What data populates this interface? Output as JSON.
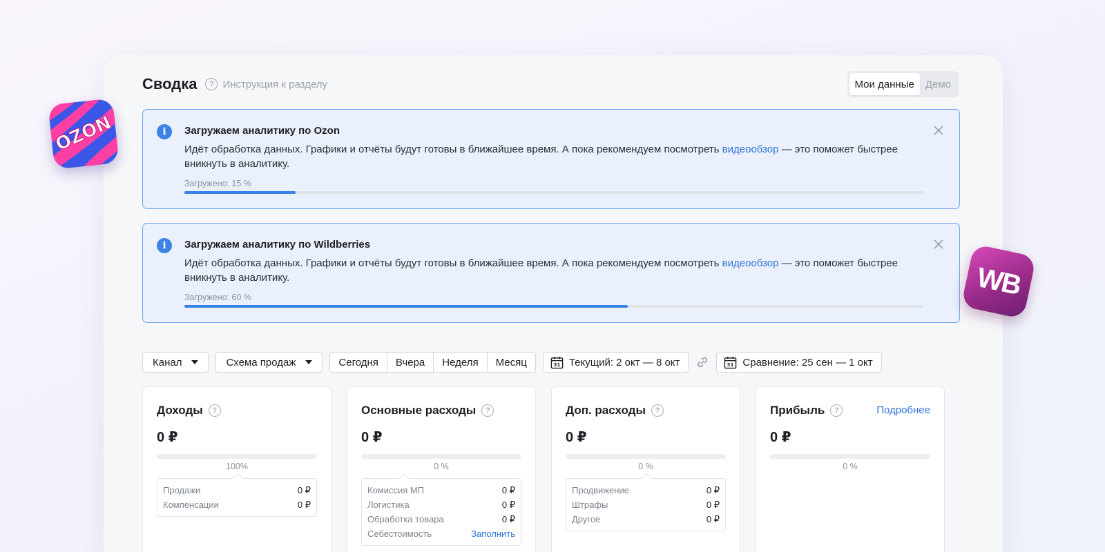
{
  "header": {
    "title": "Сводка",
    "help_label": "Инструкция к разделу",
    "toggle": {
      "mine": "Мои данные",
      "demo": "Демо"
    }
  },
  "alerts": [
    {
      "title": "Загружаем аналитику по Ozon",
      "text_before": "Идёт обработка данных. Графики и отчёты будут готовы в ближайшее время. А пока рекомендуем посмотреть ",
      "link": "видеообзор",
      "text_after": " — это поможет быстрее вникнуть в аналитику.",
      "progress_label": "Загружено: 15 %",
      "progress": 15
    },
    {
      "title": "Загружаем аналитику по Wildberries",
      "text_before": "Идёт обработка данных. Графики и отчёты будут готовы в ближайшее время. А пока рекомендуем посмотреть ",
      "link": "видеообзор",
      "text_after": " — это поможет быстрее вникнуть в аналитику.",
      "progress_label": "Загружено: 60 %",
      "progress": 60
    }
  ],
  "filters": {
    "channel": "Канал",
    "scheme": "Схема продаж",
    "periods": [
      "Сегодня",
      "Вчера",
      "Неделя",
      "Месяц"
    ],
    "current": "Текущий: 2 окт — 8 окт",
    "compare": "Сравнение: 25 сен — 1 окт",
    "calendar_day": "31"
  },
  "cards": [
    {
      "title": "Доходы",
      "value": "0 ₽",
      "pct": "100%",
      "rows": [
        {
          "label": "Продажи",
          "value": "0 ₽"
        },
        {
          "label": "Компенсации",
          "value": "0 ₽"
        }
      ]
    },
    {
      "title": "Основные расходы",
      "value": "0 ₽",
      "pct": "0 %",
      "rows": [
        {
          "label": "Комиссия МП",
          "value": "0 ₽"
        },
        {
          "label": "Логистика",
          "value": "0 ₽"
        },
        {
          "label": "Обработка товара",
          "value": "0 ₽"
        },
        {
          "label": "Себестоимость",
          "value": "Заполнить"
        }
      ]
    },
    {
      "title": "Доп. расходы",
      "value": "0 ₽",
      "pct": "0 %",
      "rows": [
        {
          "label": "Продвижение",
          "value": "0 ₽"
        },
        {
          "label": "Штрафы",
          "value": "0 ₽"
        },
        {
          "label": "Другое",
          "value": "0 ₽"
        }
      ]
    },
    {
      "title": "Прибыль",
      "link": "Подробнее",
      "value": "0 ₽",
      "pct": "0 %"
    }
  ],
  "logos": {
    "ozon": "OZON",
    "wb": "WB"
  },
  "icons": {
    "help": "question-circle-icon",
    "info": "info-icon",
    "close": "close-icon",
    "caret": "chevron-down-icon",
    "calendar": "calendar-icon",
    "link": "link-icon"
  },
  "colors": {
    "accent": "#3b82e6",
    "link": "#2f74d9",
    "alert_bg": "#eaf1fc",
    "alert_border": "#6fa3ea"
  }
}
